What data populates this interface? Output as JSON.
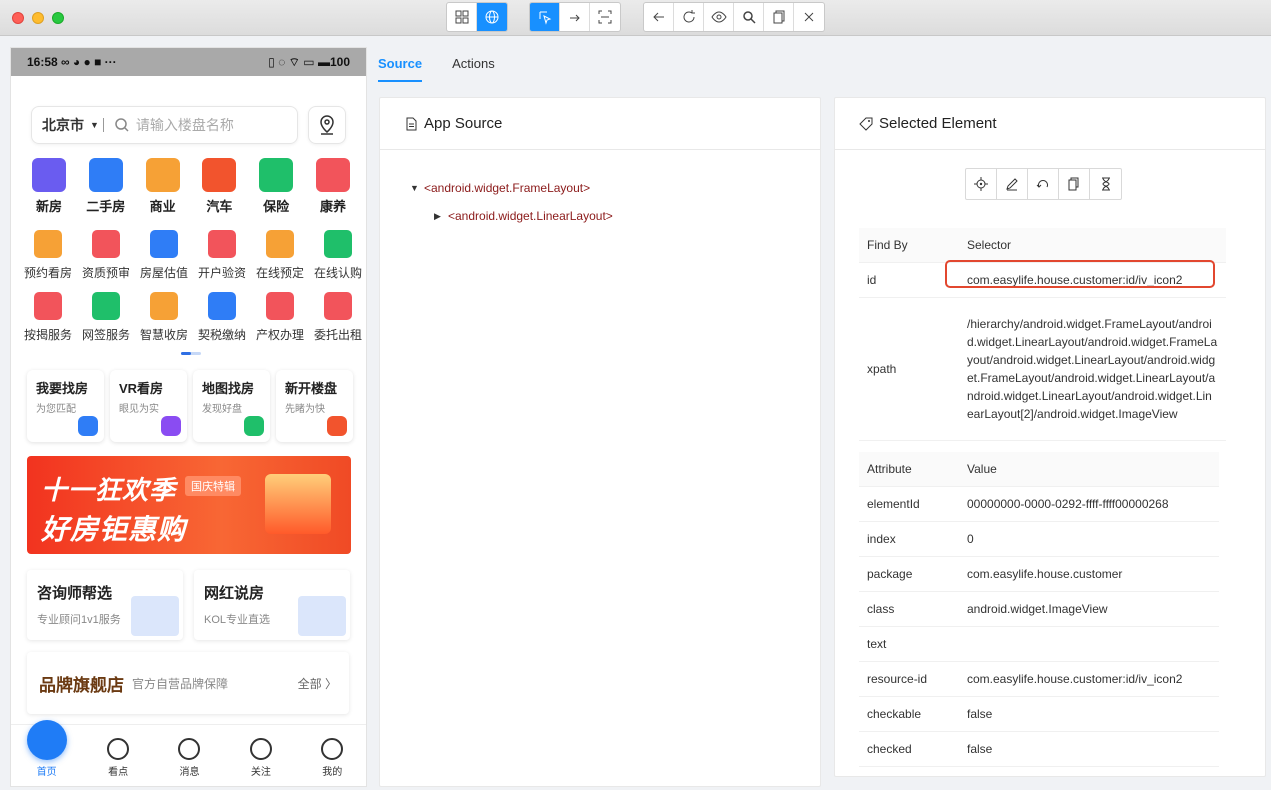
{
  "toolbar": {
    "group1": [
      "grid-icon",
      "globe-icon"
    ],
    "group2": [
      "select-icon",
      "swipe-icon",
      "screenshot-icon"
    ],
    "group3": [
      "back-icon",
      "refresh-icon",
      "eye-icon",
      "search-icon",
      "copy-icon",
      "close-icon"
    ],
    "accent": "#1890ff"
  },
  "phone": {
    "status": {
      "time": "16:58 ∞ ◕ ● ■ ···",
      "right": "▯ ◌ ⌔ ▭ ▬100"
    },
    "search": {
      "city": "北京市",
      "placeholder": "请输入楼盘名称"
    },
    "big_icons": [
      {
        "label": "新房",
        "color": "#6a5cf0"
      },
      {
        "label": "二手房",
        "color": "#2f7df6"
      },
      {
        "label": "商业",
        "color": "#f6a136"
      },
      {
        "label": "汽车",
        "color": "#f2542d"
      },
      {
        "label": "保险",
        "color": "#1fbf6a"
      },
      {
        "label": "康养",
        "color": "#f2545b"
      }
    ],
    "small_row1": [
      {
        "label": "预约看房",
        "color": "#f6a136"
      },
      {
        "label": "资质预审",
        "color": "#f2545b"
      },
      {
        "label": "房屋估值",
        "color": "#2f7df6"
      },
      {
        "label": "开户验资",
        "color": "#f2545b"
      },
      {
        "label": "在线预定",
        "color": "#f6a136"
      },
      {
        "label": "在线认购",
        "color": "#1fbf6a"
      }
    ],
    "small_row2": [
      {
        "label": "按揭服务",
        "color": "#f2545b"
      },
      {
        "label": "网签服务",
        "color": "#1fbf6a"
      },
      {
        "label": "智慧收房",
        "color": "#f6a136"
      },
      {
        "label": "契税缴纳",
        "color": "#2f7df6"
      },
      {
        "label": "产权办理",
        "color": "#f2545b"
      },
      {
        "label": "委托出租",
        "color": "#f2545b"
      }
    ],
    "cards": [
      {
        "title": "我要找房",
        "sub": "为您匹配",
        "color": "#2f7df6"
      },
      {
        "title": "VR看房",
        "sub": "眼见为实",
        "color": "#8a4cf2"
      },
      {
        "title": "地图找房",
        "sub": "发现好盘",
        "color": "#1fbf6a"
      },
      {
        "title": "新开楼盘",
        "sub": "先睹为快",
        "color": "#f2542d"
      }
    ],
    "banner": {
      "line1": "十一狂欢季",
      "line2": "好房钜惠购",
      "tag": "国庆特辑"
    },
    "promo_left": {
      "title": "咨询师帮选",
      "sub": "专业顾问1v1服务"
    },
    "promo_right": {
      "title": "网红说房",
      "sub": "KOL专业直选"
    },
    "brand": {
      "title": "品牌旗舰店",
      "sub": "官方自营品牌保障",
      "all": "全部 〉"
    },
    "nav": [
      "首页",
      "看点",
      "消息",
      "关注",
      "我的"
    ]
  },
  "tabs": [
    "Source",
    "Actions"
  ],
  "source_panel": {
    "title": "App Source",
    "tree": [
      "<android.widget.FrameLayout>",
      "<android.widget.LinearLayout>"
    ]
  },
  "selected_panel": {
    "title": "Selected Element",
    "actions": [
      "crosshair-icon",
      "edit-icon",
      "undo-icon",
      "copy-icon",
      "hourglass-icon"
    ],
    "findby_headers": [
      "Find By",
      "Selector"
    ],
    "findby": [
      {
        "k": "id",
        "v": "com.easylife.house.customer:id/iv_icon2"
      },
      {
        "k": "xpath",
        "v": "/hierarchy/android.widget.FrameLayout/android.widget.LinearLayout/android.widget.FrameLayout/android.widget.LinearLayout/android.widget.FrameLayout/android.widget.LinearLayout/android.widget.LinearLayout/android.widget.LinearLayout[2]/android.widget.ImageView"
      }
    ],
    "attr_headers": [
      "Attribute",
      "Value"
    ],
    "attrs": [
      {
        "k": "elementId",
        "v": "00000000-0000-0292-ffff-ffff00000268"
      },
      {
        "k": "index",
        "v": "0"
      },
      {
        "k": "package",
        "v": "com.easylife.house.customer"
      },
      {
        "k": "class",
        "v": "android.widget.ImageView"
      },
      {
        "k": "text",
        "v": ""
      },
      {
        "k": "resource-id",
        "v": "com.easylife.house.customer:id/iv_icon2"
      },
      {
        "k": "checkable",
        "v": "false"
      },
      {
        "k": "checked",
        "v": "false"
      }
    ]
  }
}
